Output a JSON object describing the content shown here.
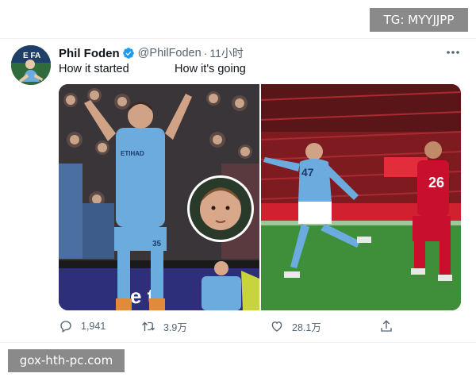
{
  "watermarks": {
    "top": "TG: MYYJJPP",
    "bottom": "gox-hth-pc.com"
  },
  "tweet": {
    "author": {
      "display_name": "Phil Foden",
      "handle": "@PhilFoden",
      "verified": true,
      "avatar_text": "E FA"
    },
    "separator": "·",
    "time": "11小时",
    "text": {
      "left": "How it started",
      "right": "How it's going"
    },
    "media": {
      "left_jersey_text": "ETIHAD",
      "left_shirt_number": "35",
      "right_shirt_number_blue": "47",
      "right_shirt_number_red": "26",
      "board_text": "e t"
    },
    "actions": {
      "replies": "1,941",
      "retweets": "3.9万",
      "likes": "28.1万"
    }
  },
  "icons": {
    "more": "more-horizontal-icon",
    "verified": "verified-badge-icon",
    "reply": "reply-icon",
    "retweet": "retweet-icon",
    "like": "heart-icon",
    "share": "share-icon"
  },
  "colors": {
    "verified_blue": "#1d9bf0",
    "secondary_text": "#536471",
    "city_blue": "#6cabdd",
    "liverpool_red": "#c8102e",
    "pitch_green": "#3f8f3a"
  }
}
